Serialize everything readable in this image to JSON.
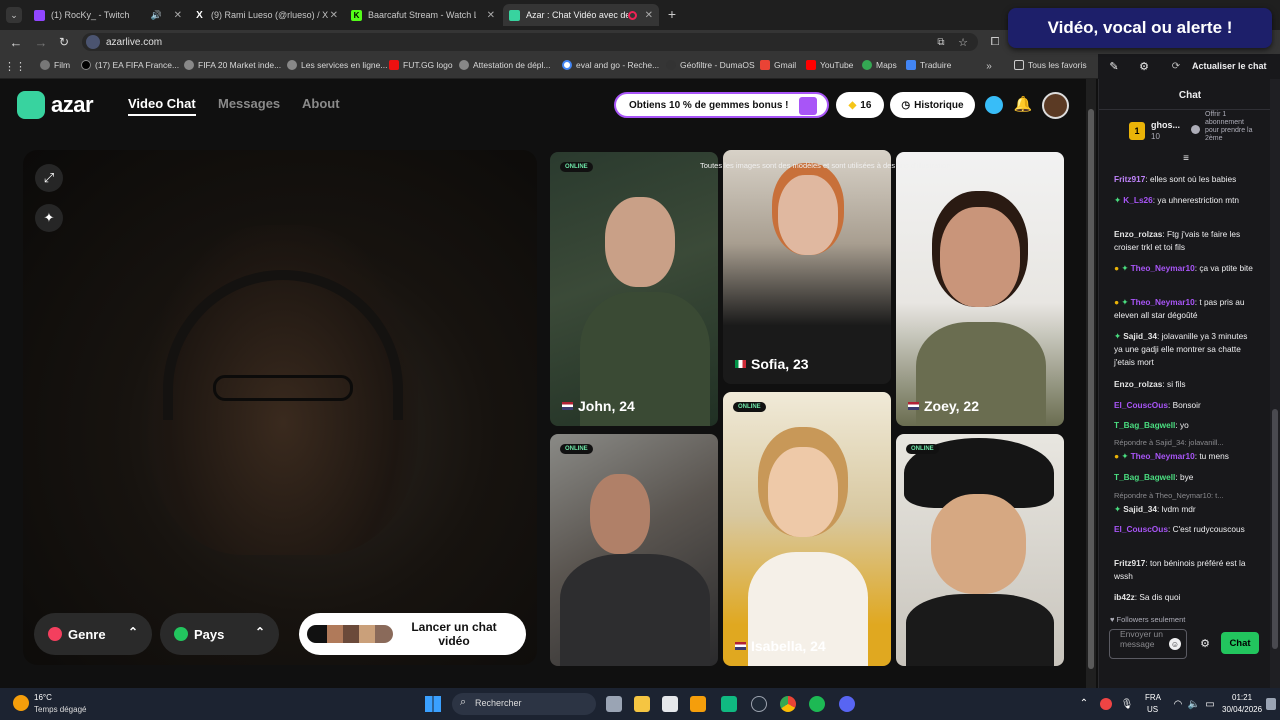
{
  "browser": {
    "tabs": [
      {
        "title": "(1) RocKy_ - Twitch",
        "color": "#9146ff"
      },
      {
        "title": "(9) Rami Lueso (@rlueso) / X",
        "color": "#ffffff"
      },
      {
        "title": "Baarcafut Stream - Watch Live",
        "color": "#53fc18"
      },
      {
        "title": "Azar : Chat Vidéo avec de",
        "color": "#38d39f"
      }
    ],
    "url": "azarlive.com",
    "bookmarks": [
      "Film",
      "(17) EA FIFA France...",
      "FIFA 20 Market inde...",
      "Les services en ligne...",
      "FUT.GG logo",
      "Attestation de dépl...",
      "eval and go - Reche...",
      "Géofiltre - DumaOS",
      "Gmail",
      "YouTube",
      "Maps",
      "Traduire"
    ],
    "bookmarks_all": "Tous les favoris"
  },
  "azar": {
    "logo": "azar",
    "nav": [
      "Video Chat",
      "Messages",
      "About"
    ],
    "gem_banner": "Obtiens 10 % de gemmes bonus !",
    "gems": "16",
    "history": "Historique",
    "filters": {
      "genre": "Genre",
      "country": "Pays"
    },
    "launch": "Lancer un chat vidéo",
    "overlay_text": "Toutes les images sont des modèles et sont utilisées à des fins d'illustration",
    "online_label": "ONLINE",
    "profiles": [
      {
        "name": "John, 24",
        "flag": "us"
      },
      {
        "name": "Sofia, 23",
        "flag": "it"
      },
      {
        "name": "Zoey, 22",
        "flag": "us"
      },
      {
        "name": "Isabella, 24",
        "flag": "us"
      }
    ]
  },
  "twitch": {
    "action": "Actualiser le chat",
    "title": "Chat",
    "gift_user": "ghos...",
    "gift_count": "10",
    "gift_text": "Offrir 1 abonnement pour prendre la 2ème",
    "messages": [
      {
        "user": "Fritz917",
        "color": "#c084fc",
        "text": "elles sont où les babies"
      },
      {
        "user": "K_Ls26",
        "color": "#a855f7",
        "text": "ya uhnerestriction mtn"
      },
      {
        "user": "Enzo_rolzas",
        "color": "#e5e5e5",
        "text": "Ftg j'vais te faire les croiser trkl et toi fils"
      },
      {
        "user": "Theo_Neymar10",
        "color": "#a855f7",
        "text": "ça va ptite bite"
      },
      {
        "user": "Theo_Neymar10",
        "color": "#a855f7",
        "text": "t pas pris au eleven all star dégoûté"
      },
      {
        "user": "Sajid_34",
        "color": "#e5e5e5",
        "text": "jolavanille ya 3 minutes ya une gadji elle montrer sa chatte j'etais mort"
      },
      {
        "user": "Enzo_rolzas",
        "color": "#e5e5e5",
        "text": "si fils"
      },
      {
        "user": "El_CouscOus",
        "color": "#a855f7",
        "text": "Bonsoir"
      },
      {
        "user": "T_Bag_Bagwell",
        "color": "#4ade80",
        "text": "yo"
      },
      {
        "user": "Theo_Neymar10",
        "color": "#a855f7",
        "text": "tu mens"
      },
      {
        "user": "T_Bag_Bagwell",
        "color": "#4ade80",
        "text": "bye"
      },
      {
        "user": "Sajid_34",
        "color": "#e5e5e5",
        "text": "lvdm mdr"
      },
      {
        "user": "El_CouscOus",
        "color": "#a855f7",
        "text": "C'est rudycouscous"
      },
      {
        "user": "Fritz917",
        "color": "#e5e5e5",
        "text": "ton béninois préféré est la wssh"
      },
      {
        "user": "ib42z",
        "color": "#e5e5e5",
        "text": "Sa dis quoi"
      }
    ],
    "replies": [
      "Répondre à Sajid_34: jolavanill...",
      "Répondre à Theo_Neymar10: t..."
    ],
    "followers_only": "Followers seulement",
    "input_placeholder": "Envoyer un message",
    "send": "Chat"
  },
  "overlay_banner": "Vidéo, vocal ou alerte !",
  "taskbar": {
    "weather_temp": "16°C",
    "weather_desc": "Temps dégagé",
    "search": "Rechercher",
    "lang": "FRA",
    "region": "US",
    "time": "01:21",
    "date": "30/04/2026"
  }
}
